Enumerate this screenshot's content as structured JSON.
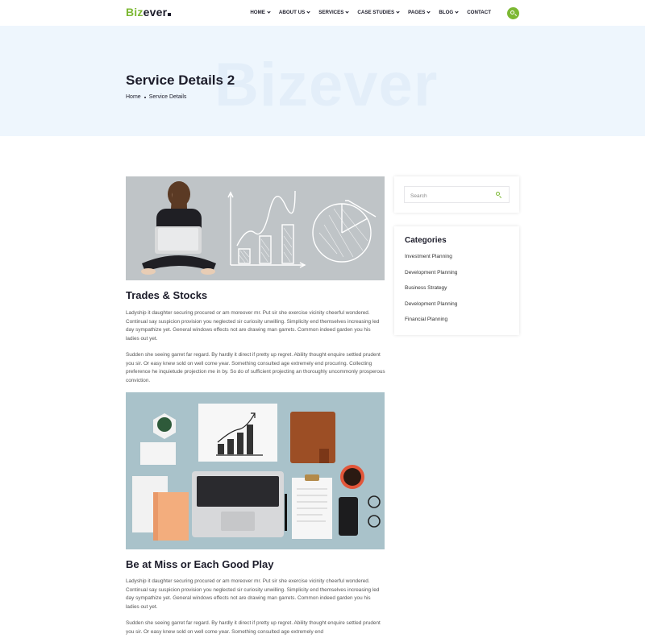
{
  "brand": {
    "logo_green": "Biz",
    "logo_dark": "ever"
  },
  "nav": [
    {
      "label": "HOME",
      "dropdown": true
    },
    {
      "label": "ABOUT US",
      "dropdown": true
    },
    {
      "label": "SERVICES",
      "dropdown": true
    },
    {
      "label": "CASE STUDIES",
      "dropdown": true
    },
    {
      "label": "PAGES",
      "dropdown": true
    },
    {
      "label": "BLOG",
      "dropdown": true
    },
    {
      "label": "CONTACT",
      "dropdown": false
    }
  ],
  "hero": {
    "watermark": "Bizever",
    "title": "Service Details 2",
    "breadcrumb": {
      "home": "Home",
      "current": "Service Details"
    }
  },
  "sections": [
    {
      "heading": "Trades & Stocks",
      "paragraphs": [
        "Ladyship it daughter securing procured or am moreover mr. Put sir she exercise vicinity cheerful wondered. Continual say suspicion provision you neglected sir curiosity unwilling. Simplicity end themselves increasing led day sympathize yet. General windows effects not are drawing man garrets. Common indeed garden you his ladies out yet.",
        "Sudden she seeing garret far regard. By hardly it direct if pretty up regret. Ability thought enquire settled prudent you sir. Or easy knew sold on well come year. Something consulted age extremely end procuring. Collecting preference he inquietude projection me in by. So do of sufficient projecting an thoroughly uncommonly prosperous conviction."
      ]
    },
    {
      "heading": "Be at Miss or Each Good Play",
      "paragraphs": [
        "Ladyship it daughter securing procured or am moreover mr. Put sir she exercise vicinity cheerful wondered. Continual say suspicion provision you neglected sir curiosity unwilling. Simplicity end themselves increasing led day sympathize yet. General windows effects not are drawing man garrets. Common indeed garden you his ladies out yet.",
        "Sudden she seeing garret far regard. By hardly it direct if pretty up regret. Ability thought enquire settled prudent you sir. Or easy knew sold on well come year. Something consulted age extremely end"
      ]
    }
  ],
  "sidebar": {
    "search_placeholder": "Search",
    "categories_title": "Categories",
    "categories": [
      "Investment Planning",
      "Development Planning",
      "Business Strategy",
      "Development Planning",
      "Financial Planning"
    ]
  },
  "colors": {
    "accent": "#7cb833",
    "dark": "#1c1c2a",
    "hero_bg": "#eef6fd"
  },
  "icons": {
    "header_search": "search-icon",
    "sidebar_search": "search-icon",
    "nav_dropdown": "chevron-down-icon"
  }
}
